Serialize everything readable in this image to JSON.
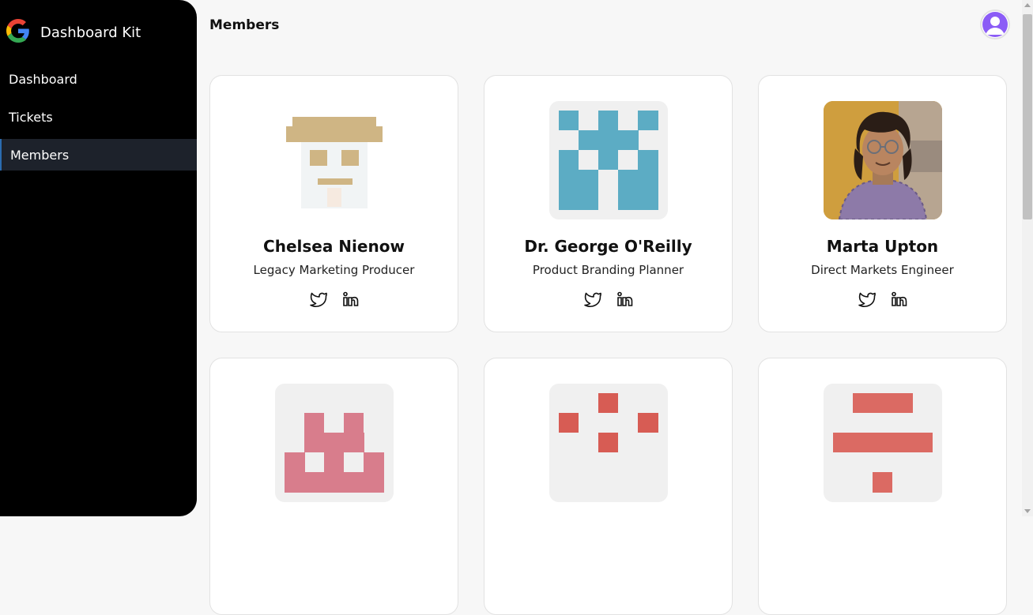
{
  "app": {
    "brand": "Dashboard Kit",
    "page_title": "Members"
  },
  "sidebar": {
    "items": [
      {
        "label": "Dashboard",
        "active": false
      },
      {
        "label": "Tickets",
        "active": false
      },
      {
        "label": "Members",
        "active": true
      }
    ]
  },
  "members": [
    {
      "name": "Chelsea Nienow",
      "role": "Legacy Marketing Producer",
      "avatar": "pixel-hat-face-avatar"
    },
    {
      "name": "Dr. George O'Reilly",
      "role": "Product Branding Planner",
      "avatar": "blue-pixel-identicon-avatar"
    },
    {
      "name": "Marta Upton",
      "role": "Direct Markets Engineer",
      "avatar": "person-photo-avatar"
    },
    {
      "name": "",
      "role": "",
      "avatar": "pink-pixel-identicon-avatar"
    },
    {
      "name": "",
      "role": "",
      "avatar": "red-dots-identicon-avatar"
    },
    {
      "name": "",
      "role": "",
      "avatar": "red-bars-identicon-avatar"
    }
  ],
  "icons": {
    "twitter": "twitter-icon",
    "linkedin": "linkedin-icon",
    "brand": "google-icon",
    "user": "user-avatar-icon"
  },
  "colors": {
    "sidebar_bg": "#000000",
    "active_item_bg": "#1d222b",
    "avatar_purple": "#8b5cf6"
  }
}
